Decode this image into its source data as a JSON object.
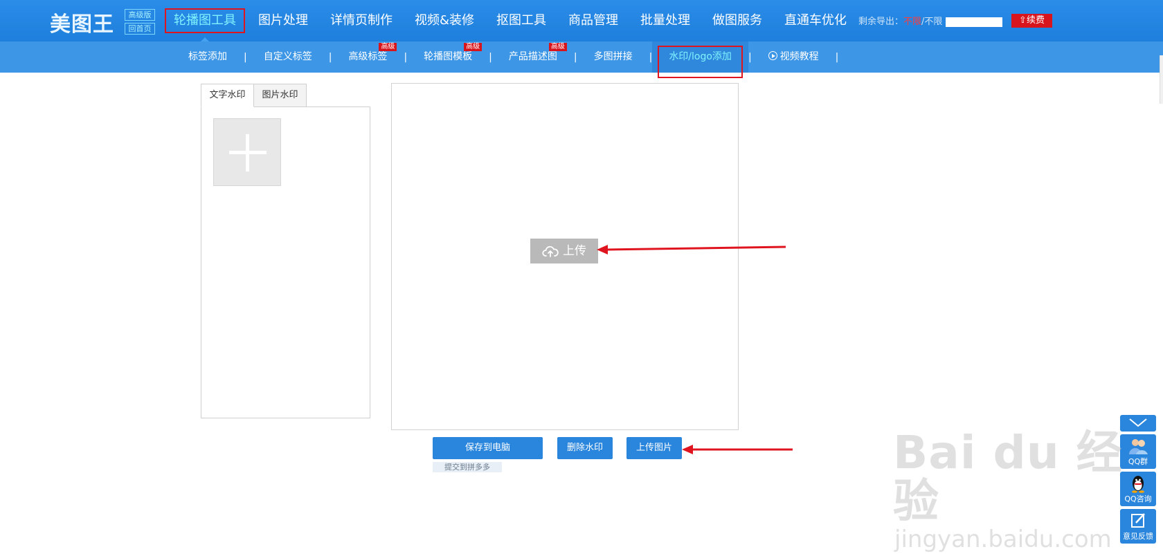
{
  "header": {
    "logo_text": "美图王",
    "badge_edition": "高级版",
    "badge_home": "回首页",
    "nav": [
      {
        "label": "轮播图工具",
        "active": true
      },
      {
        "label": "图片处理"
      },
      {
        "label": "详情页制作"
      },
      {
        "label": "视频&装修"
      },
      {
        "label": "抠图工具"
      },
      {
        "label": "商品管理"
      },
      {
        "label": "批量处理"
      },
      {
        "label": "做图服务"
      },
      {
        "label": "直通车优化"
      }
    ],
    "export_label": "剩余导出：",
    "export_value": "不限",
    "export_suffix": "/不限",
    "renew_label": "续费"
  },
  "subnav": {
    "items": [
      {
        "label": "标签添加"
      },
      {
        "label": "自定义标签"
      },
      {
        "label": "高级标签",
        "badge": "高级"
      },
      {
        "label": "轮播图模板",
        "badge": "高级"
      },
      {
        "label": "产品描述图",
        "badge": "高级"
      },
      {
        "label": "多图拼接"
      },
      {
        "label": "水印/logo添加",
        "active": true
      },
      {
        "label": "视频教程"
      }
    ]
  },
  "left_panel": {
    "tabs": [
      {
        "label": "文字水印",
        "active": true
      },
      {
        "label": "图片水印"
      }
    ]
  },
  "canvas": {
    "upload_label": "上传"
  },
  "actions": {
    "save_label": "保存到电脑",
    "delete_label": "删除水印",
    "upload_label": "上传图片",
    "submit_label": "提交到拼多多"
  },
  "side_tools": {
    "qq_group": "QQ群",
    "qq_consult": "QQ咨询",
    "feedback": "意见反馈"
  },
  "watermark": {
    "brand": "Bai du 经验",
    "url": "jingyan.baidu.com"
  },
  "colors": {
    "header_blue": "#1f7fdc",
    "subbar_blue": "#3e97e6",
    "active_cyan": "#7ff3ff",
    "highlight_red": "#e0141e",
    "button_blue": "#2a86dc"
  }
}
